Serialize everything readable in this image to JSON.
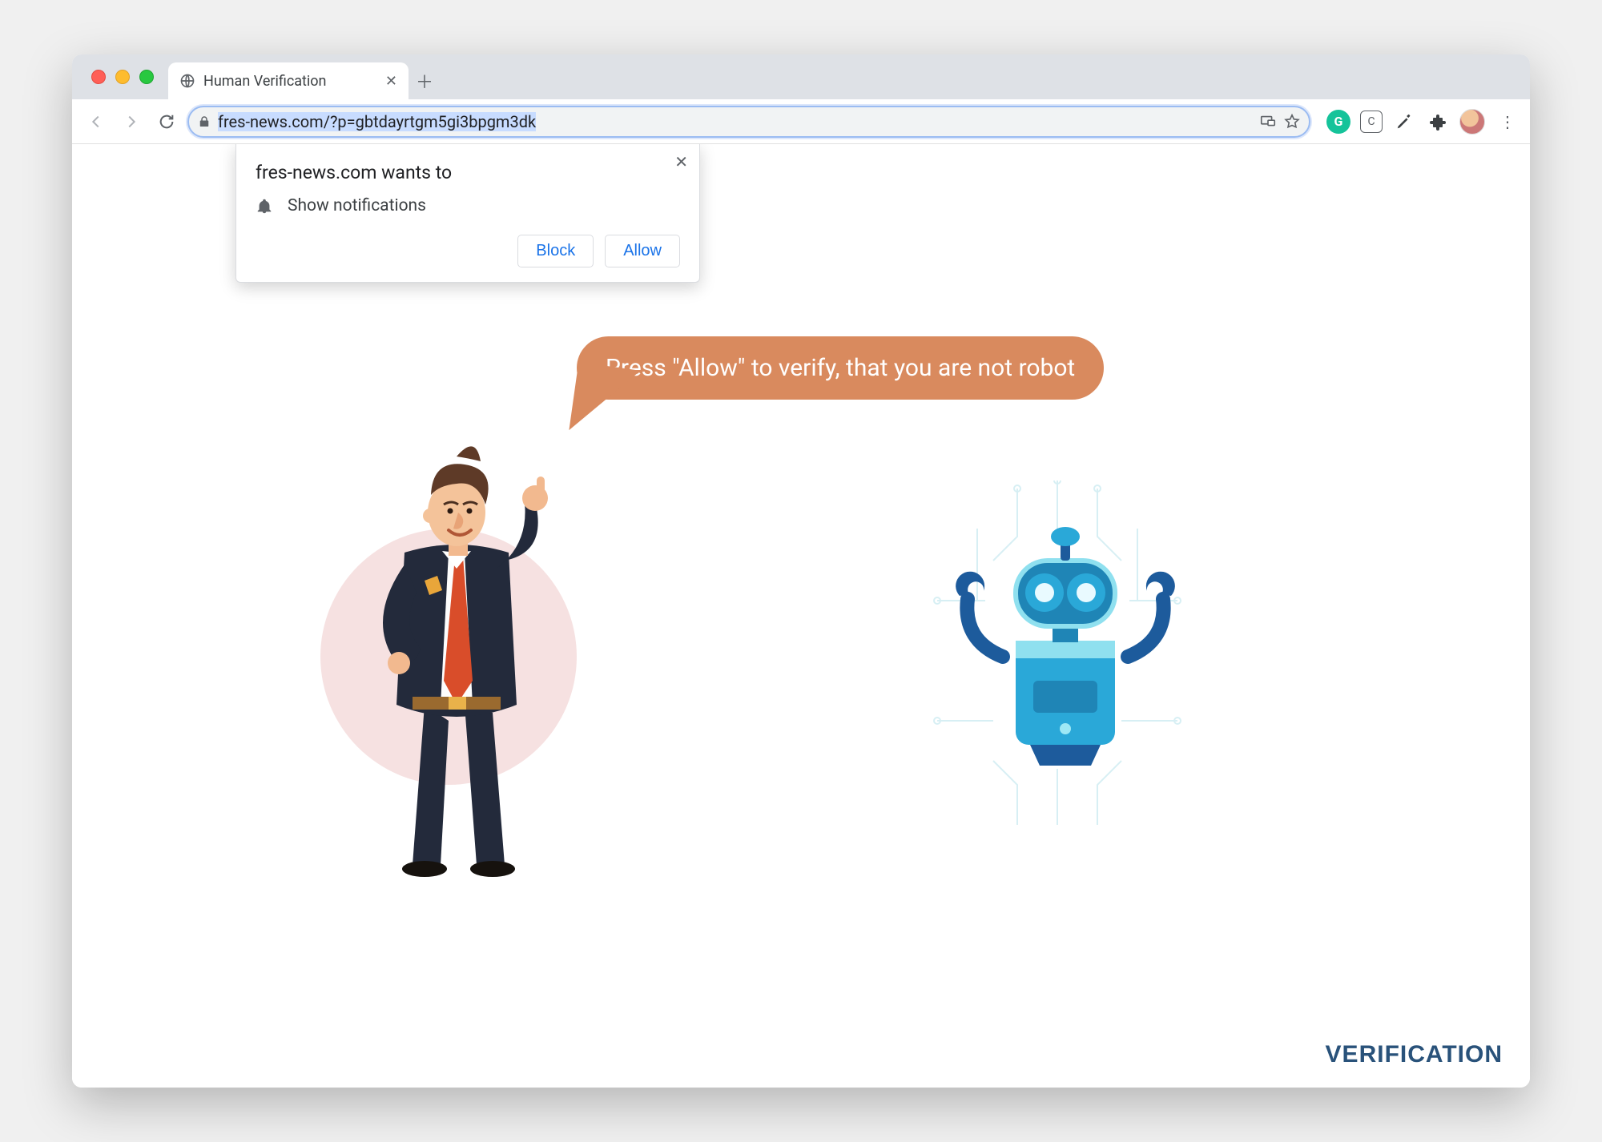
{
  "tab": {
    "title": "Human Verification"
  },
  "url": {
    "text": "fres-news.com/?p=gbtdayrtgm5gi3bpgm3dk"
  },
  "permission": {
    "title": "fres-news.com wants to",
    "item": "Show notifications",
    "block": "Block",
    "allow": "Allow"
  },
  "bubble": {
    "text": "Press \"Allow\" to verify, that you are not robot"
  },
  "footer": {
    "label": "VERIFICATION"
  },
  "extensions": {
    "grammarly_letter": "G",
    "clip_letter": "C"
  }
}
